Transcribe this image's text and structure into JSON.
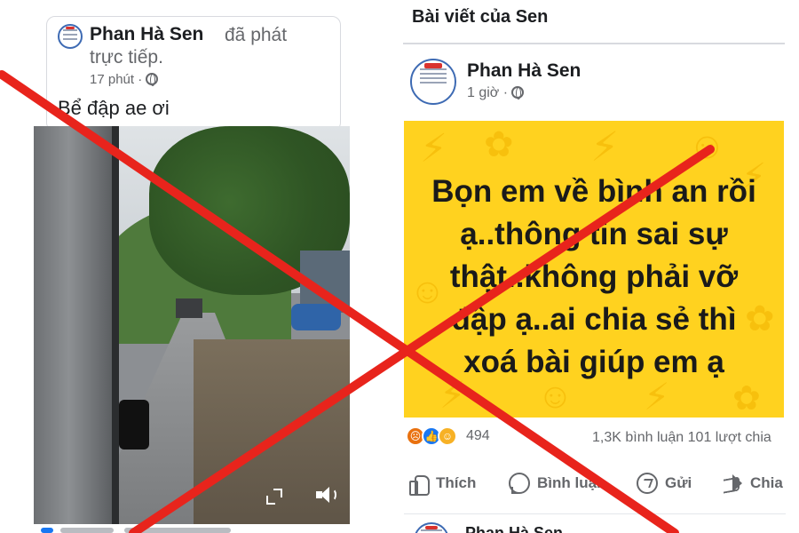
{
  "left_post": {
    "author": "Phan Hà Sen",
    "action_line1": "đã phát",
    "action_line2": "trực tiếp.",
    "time": "17 phút ·",
    "caption": "Bể đập ae ơi",
    "video_controls": {
      "fullscreen_icon": "fullscreen-icon",
      "volume_icon": "volume-icon"
    }
  },
  "right_post": {
    "section_header": "Bài viết của Sen",
    "author": "Phan Hà Sen",
    "time": "1 giờ ·",
    "banner_text": "Bọn em về bình an rồi\nạ..thông tin sai sự\nthật..không phải vỡ\nđập ạ..ai chia sẻ thì\nxoá bài giúp em ạ",
    "banner_color": "#ffd21f",
    "reactions_count": "494",
    "comments_shares": "1,3K bình luận   101 lượt chia",
    "actions": {
      "like": "Thích",
      "comment": "Bình luận",
      "send": "Gửi",
      "share": "Chia"
    },
    "next_post_author": "Phan Hà Sen"
  },
  "overlay": {
    "x_color": "#e8241c"
  }
}
